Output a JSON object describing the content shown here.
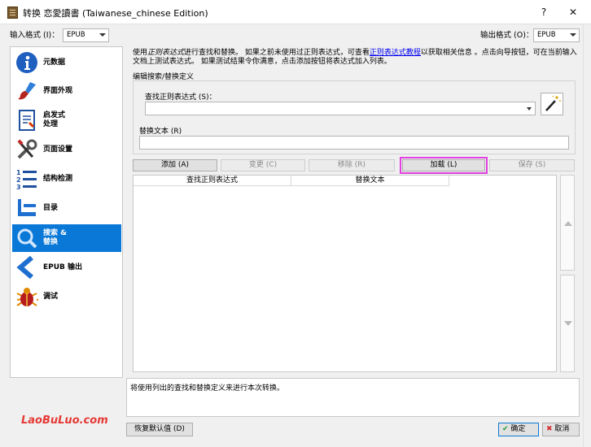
{
  "window": {
    "title": "转换 恋愛讀書 (Taiwanese_chinese Edition)",
    "help_label": "?",
    "close_label": "✕"
  },
  "input_format": {
    "label": "输入格式 (I)：",
    "value": "EPUB"
  },
  "output_format": {
    "label": "输出格式 (O)：",
    "value": "EPUB"
  },
  "sidebar": {
    "items": [
      {
        "label": "元数据",
        "icon": "info-icon"
      },
      {
        "label": "界面外观",
        "icon": "paintbrush-icon"
      },
      {
        "label": "启发式\n处理",
        "icon": "document-icon"
      },
      {
        "label": "页面设置",
        "icon": "tools-icon"
      },
      {
        "label": "结构检测",
        "icon": "list-icon"
      },
      {
        "label": "目录",
        "icon": "toc-icon"
      },
      {
        "label": "搜索 &\n替换",
        "icon": "search-icon"
      },
      {
        "label": "EPUB 输出",
        "icon": "chevron-left-icon"
      },
      {
        "label": "调试",
        "icon": "bug-icon"
      }
    ],
    "active_index": 6
  },
  "description": {
    "part1": "使用",
    "italic": "正则表达式",
    "part2": "进行查找和替换。 如果之前未使用过正则表达式，可查看",
    "link": "正则表达式教程",
    "part3": "以获取相关信息 。点击向导按钮，可在当前输入文档上测试表达式。 如果测试结果令你满意，点击添加按钮将表达式加入列表。"
  },
  "editor": {
    "group_title": "编辑搜索/替换定义",
    "search_label": "查找正则表达式 (S)：",
    "search_value": "",
    "replace_label": "替换文本 (R)",
    "replace_value": "",
    "wand_icon": "magic-wand-icon"
  },
  "buttons": {
    "add": "添加 (A)",
    "change": "变更 (C)",
    "remove": "移除 (R)",
    "load": "加载 (L)",
    "save": "保存 (S)"
  },
  "table": {
    "columns": [
      "查找正则表达式",
      "替换文本"
    ],
    "rows": []
  },
  "help_text": "将使用列出的查找和替换定义来进行本次转换。",
  "footer": {
    "watermark": "LaoBuLuo.com",
    "restore_defaults": "恢复默认值 (D)",
    "ok": "确定",
    "cancel": "取消"
  },
  "colors": {
    "active_item": "#0a78d7",
    "highlight_outline": "#e23fe0",
    "link": "#0000ee",
    "watermark": "#e53935"
  }
}
